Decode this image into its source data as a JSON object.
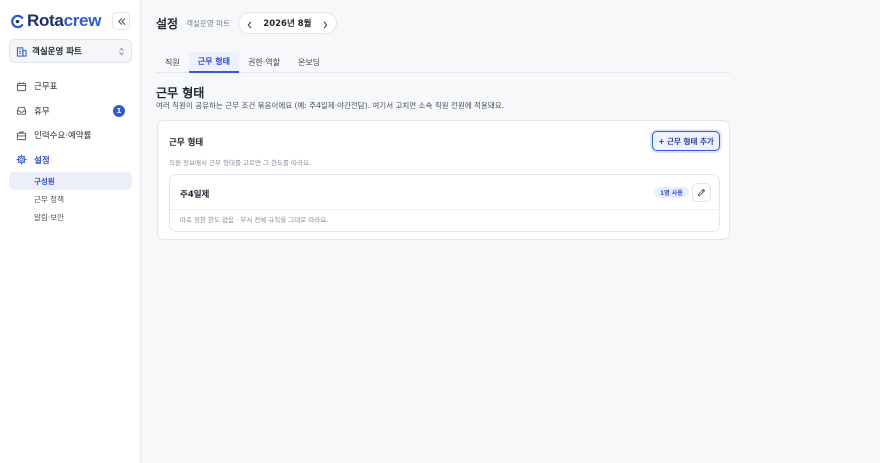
{
  "app": {
    "brand_prefix": "Rota",
    "brand_suffix": "crew"
  },
  "sidebar": {
    "team": "객실운영 파트",
    "items": [
      {
        "label": "근무표"
      },
      {
        "label": "휴무",
        "badge": "1"
      },
      {
        "label": "인력수요·예약률"
      },
      {
        "label": "설정"
      }
    ],
    "subitems": [
      {
        "label": "구성원"
      },
      {
        "label": "근무 정책"
      },
      {
        "label": "알림·보안"
      }
    ]
  },
  "header": {
    "title": "설정",
    "subtitle": "객실운영 파트",
    "month": "2026년 8월"
  },
  "tabs": [
    {
      "label": "직원"
    },
    {
      "label": "근무 형태"
    },
    {
      "label": "권한·역할"
    },
    {
      "label": "온보딩"
    }
  ],
  "section": {
    "title": "근무 형태",
    "description": "여러 직원이 공유하는 근무 조건 묶음이에요 (예: 주4일제·야간전담). 여기서 고치면 소속 직원 전원에 적용돼요."
  },
  "card": {
    "title": "근무 형태",
    "add_label": "+ 근무 형태 추가",
    "help": "직원 정보에서 근무 형태를 고르면 그 한도를 따라요.",
    "items": [
      {
        "name": "주4일제",
        "usage": "1명 사용",
        "description": "따로 정한 한도 없음 · 부서 전체 규칙을 그대로 따라요."
      }
    ]
  },
  "colors": {
    "accent": "#2f5bd6",
    "brand_dark": "#1f2f6e",
    "background": "#f7f8fa"
  },
  "icons": {
    "logo": "rotacrew-logo-icon",
    "collapse": "double-chevron-left-icon",
    "team": "building-icon",
    "select": "chevron-updown-icon",
    "nav": [
      "calendar-icon",
      "inbox-icon",
      "briefcase-icon",
      "gear-icon"
    ],
    "prev": "chevron-left-icon",
    "next": "chevron-right-icon",
    "edit": "pencil-icon"
  }
}
